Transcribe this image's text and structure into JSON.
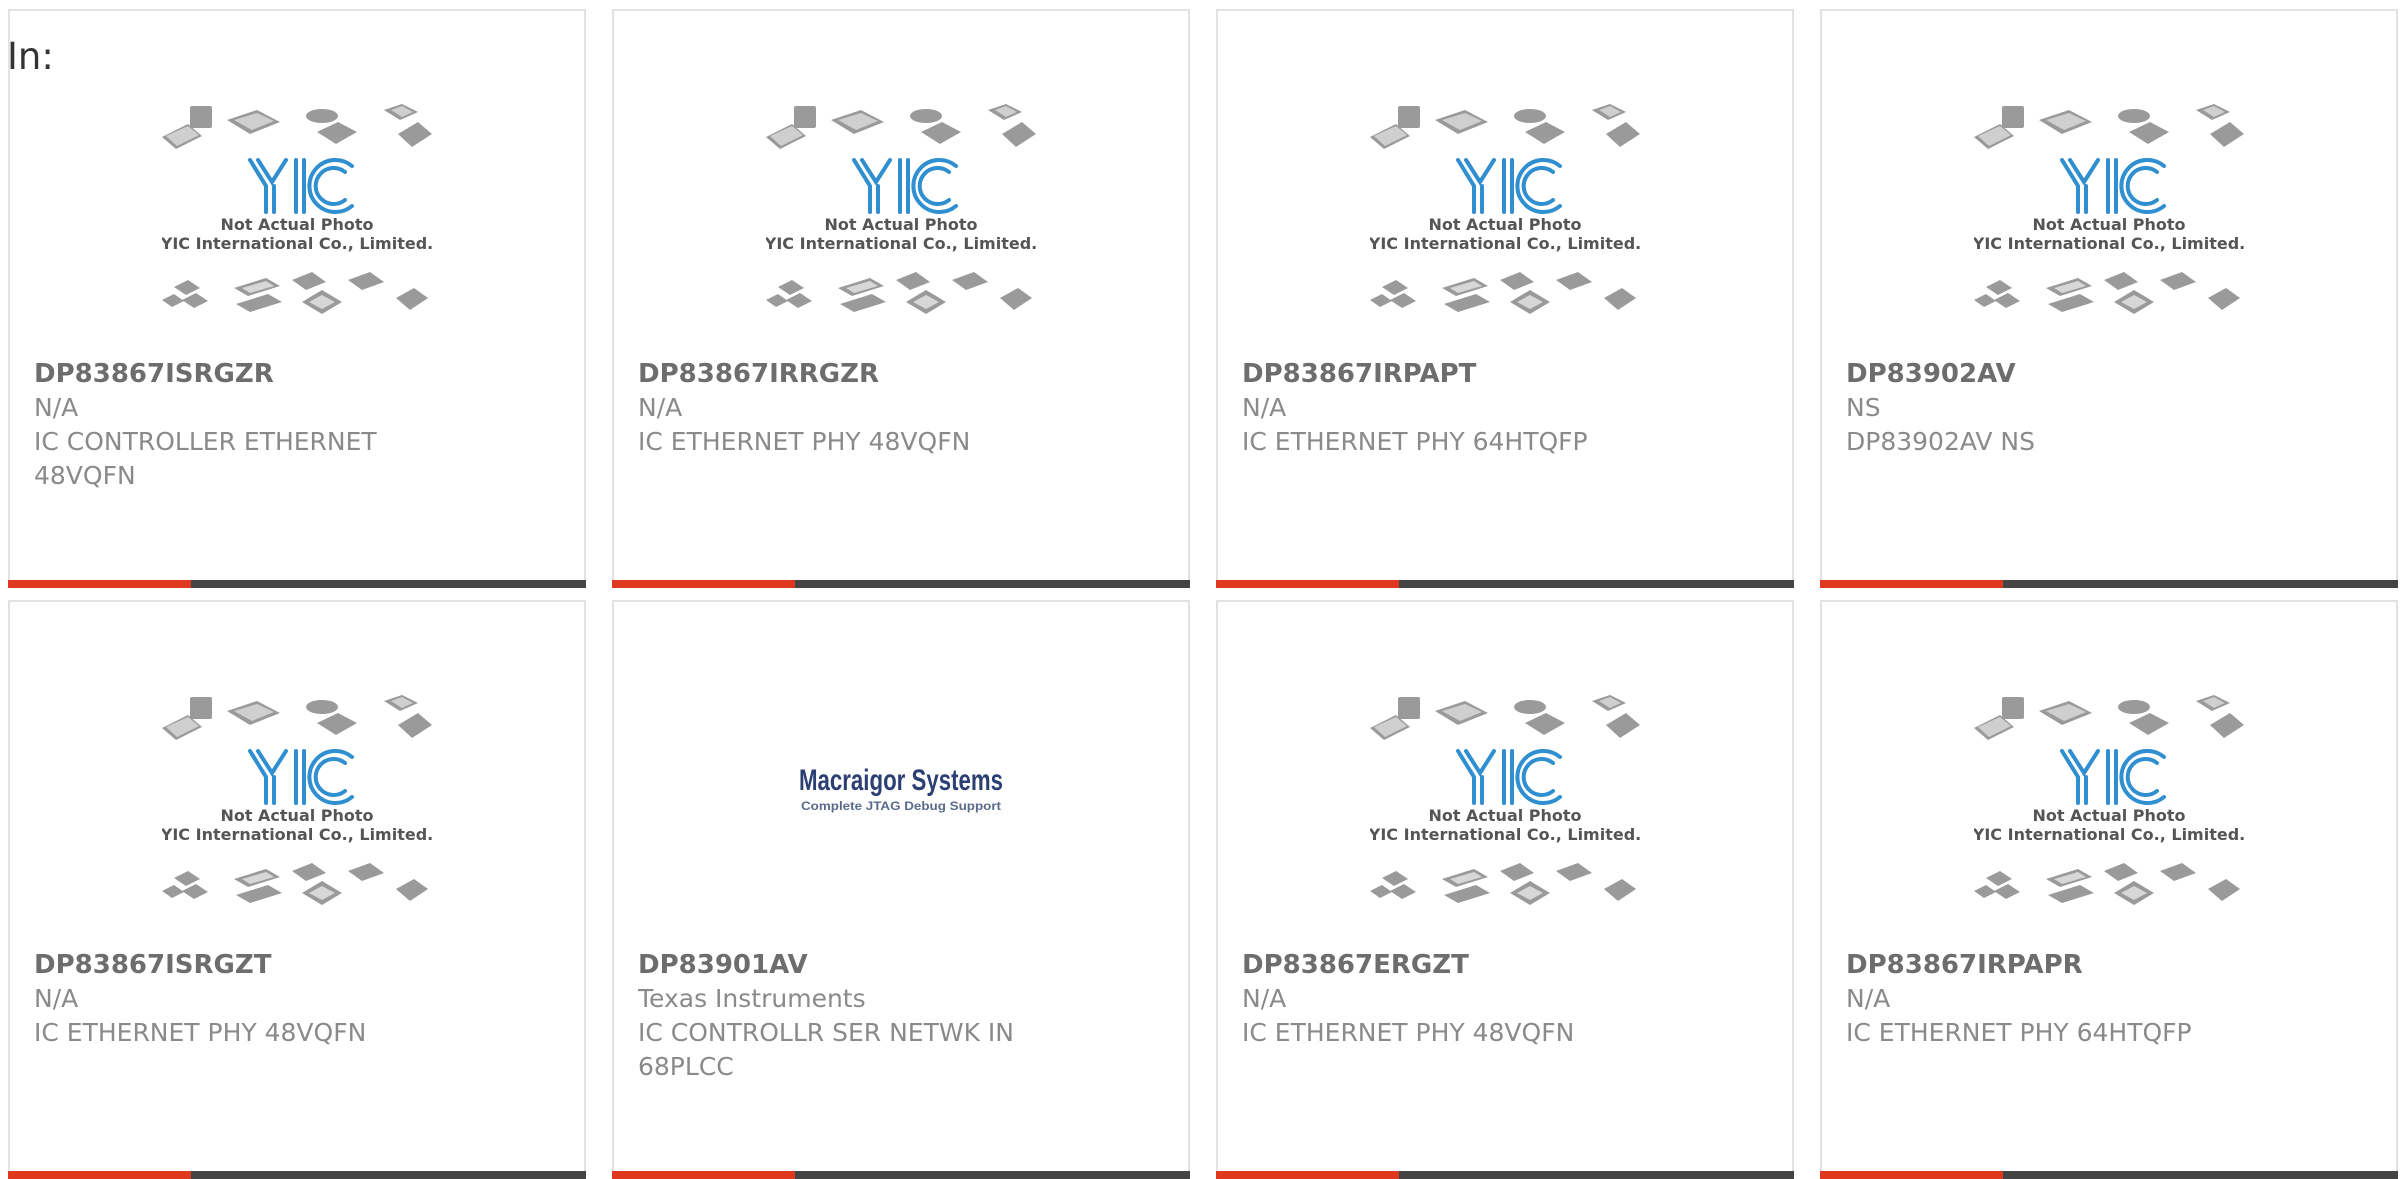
{
  "header": {
    "in_label": "In:"
  },
  "placeholder": {
    "line1": "Not Actual Photo",
    "line2": "YIC International Co., Limited.",
    "brand": "YIC"
  },
  "macraigor": {
    "title": "Macraigor Systems",
    "tagline": "Complete JTAG Debug Support"
  },
  "colors": {
    "accent": "#e0381f",
    "bar": "#444444",
    "border": "#e2e2e2"
  },
  "products": [
    {
      "part": "DP83867ISRGZR",
      "mfr": "N/A",
      "desc": "IC CONTROLLER ETHERNET 48VQFN",
      "image": "placeholder"
    },
    {
      "part": "DP83867IRRGZR",
      "mfr": "N/A",
      "desc": "IC ETHERNET PHY 48VQFN",
      "image": "placeholder"
    },
    {
      "part": "DP83867IRPAPT",
      "mfr": "N/A",
      "desc": "IC ETHERNET PHY 64HTQFP",
      "image": "placeholder"
    },
    {
      "part": "DP83902AV",
      "mfr": "NS",
      "desc": "DP83902AV NS",
      "image": "placeholder"
    },
    {
      "part": "DP83867ISRGZT",
      "mfr": "N/A",
      "desc": "IC ETHERNET PHY 48VQFN",
      "image": "placeholder"
    },
    {
      "part": "DP83901AV",
      "mfr": "Texas Instruments",
      "desc": "IC CONTROLLR SER NETWK IN 68PLCC",
      "image": "macraigor"
    },
    {
      "part": "DP83867ERGZT",
      "mfr": "N/A",
      "desc": "IC ETHERNET PHY 48VQFN",
      "image": "placeholder"
    },
    {
      "part": "DP83867IRPAPR",
      "mfr": "N/A",
      "desc": "IC ETHERNET PHY 64HTQFP",
      "image": "placeholder"
    }
  ]
}
